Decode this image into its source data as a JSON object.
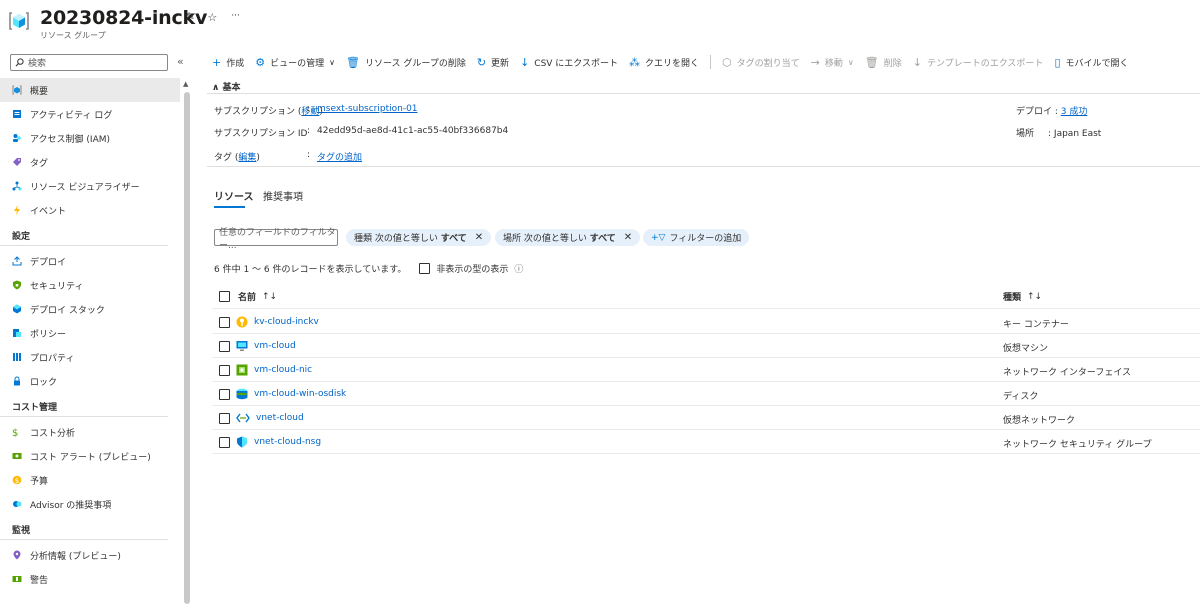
{
  "header": {
    "title": "20230824-inckv",
    "subtitle": "リソース グループ",
    "pin_glyph": "✏",
    "star_glyph": "☆",
    "more_glyph": "···"
  },
  "sidebar": {
    "search_placeholder": "検索",
    "collapse_glyph": "«",
    "items": [
      {
        "label": "概要",
        "icon": "overview-icon",
        "active": true
      },
      {
        "label": "アクティビティ ログ",
        "icon": "activity-log-icon"
      },
      {
        "label": "アクセス制御 (IAM)",
        "icon": "iam-icon"
      },
      {
        "label": "タグ",
        "icon": "tag-icon"
      },
      {
        "label": "リソース ビジュアライザー",
        "icon": "visualizer-icon"
      },
      {
        "label": "イベント",
        "icon": "event-icon"
      }
    ],
    "section_settings": "設定",
    "settings_items": [
      {
        "label": "デプロイ",
        "icon": "deploy-icon"
      },
      {
        "label": "セキュリティ",
        "icon": "security-icon"
      },
      {
        "label": "デプロイ スタック",
        "icon": "deploy-stack-icon"
      },
      {
        "label": "ポリシー",
        "icon": "policy-icon"
      },
      {
        "label": "プロパティ",
        "icon": "properties-icon"
      },
      {
        "label": "ロック",
        "icon": "lock-icon"
      }
    ],
    "section_cost": "コスト管理",
    "cost_items": [
      {
        "label": "コスト分析",
        "icon": "cost-analysis-icon"
      },
      {
        "label": "コスト アラート (プレビュー)",
        "icon": "cost-alert-icon"
      },
      {
        "label": "予算",
        "icon": "budget-icon"
      },
      {
        "label": "Advisor の推奨事項",
        "icon": "advisor-icon"
      }
    ],
    "section_monitor": "監視",
    "monitor_items": [
      {
        "label": "分析情報 (プレビュー)",
        "icon": "insights-icon"
      },
      {
        "label": "警告",
        "icon": "alert-icon"
      }
    ]
  },
  "toolbar": {
    "create": "作成",
    "manage_view": "ビューの管理",
    "delete_rg": "リソース グループの削除",
    "refresh": "更新",
    "export_csv": "CSV にエクスポート",
    "open_query": "クエリを開く",
    "assign_tags": "タグの割り当て",
    "move": "移動",
    "delete": "削除",
    "export_template": "テンプレートのエクスポート",
    "open_mobile": "モバイルで開く"
  },
  "essentials": {
    "header": "基本",
    "subscription_label": "サブスクリプション",
    "move_link": "移動",
    "subscription_value": "msext-subscription-01",
    "subscription_id_label": "サブスクリプション ID",
    "subscription_id_value": "42edd95d-ae8d-41c1-ac55-40bf336687b4",
    "tags_label": "タグ",
    "edit_link": "編集",
    "tags_value": "タグの追加",
    "deploy_label": "デプロイ",
    "deploy_value": "3 成功",
    "location_label": "場所",
    "location_value": "Japan East"
  },
  "tabs": {
    "resources": "リソース",
    "recommendations": "推奨事項"
  },
  "filters": {
    "placeholder": "任意のフィールドのフィルター...",
    "type_key": "種類",
    "type_op": "次の値と等しい",
    "type_val": "すべて",
    "loc_key": "場所",
    "loc_op": "次の値と等しい",
    "loc_val": "すべて",
    "add_filter": "フィルターの追加"
  },
  "records": {
    "summary": "6 件中 1 ～ 6 件のレコードを表示しています。",
    "show_hidden": "非表示の型の表示"
  },
  "table": {
    "col_name": "名前",
    "col_type": "種類",
    "sort_glyph": "↑↓",
    "rows": [
      {
        "name": "kv-cloud-inckv",
        "type": "キー コンテナー",
        "icon": "key-vault-icon"
      },
      {
        "name": "vm-cloud",
        "type": "仮想マシン",
        "icon": "virtual-machine-icon"
      },
      {
        "name": "vm-cloud-nic",
        "type": "ネットワーク インターフェイス",
        "icon": "network-interface-icon"
      },
      {
        "name": "vm-cloud-win-osdisk",
        "type": "ディスク",
        "icon": "disk-icon"
      },
      {
        "name": "vnet-cloud",
        "type": "仮想ネットワーク",
        "icon": "virtual-network-icon"
      },
      {
        "name": "vnet-cloud-nsg",
        "type": "ネットワーク セキュリティ グループ",
        "icon": "nsg-icon"
      }
    ]
  }
}
